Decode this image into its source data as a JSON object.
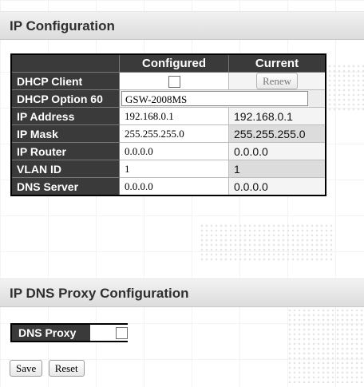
{
  "ip_config": {
    "title": "IP Configuration",
    "columns": {
      "configured": "Configured",
      "current": "Current"
    },
    "dhcp_client": {
      "label": "DHCP Client",
      "checked": false,
      "renew_label": "Renew"
    },
    "dhcp_option_60": {
      "label": "DHCP Option 60",
      "value": "GSW-2008MS"
    },
    "ip_address": {
      "label": "IP Address",
      "configured": "192.168.0.1",
      "current": "192.168.0.1"
    },
    "ip_mask": {
      "label": "IP Mask",
      "configured": "255.255.255.0",
      "current": "255.255.255.0"
    },
    "ip_router": {
      "label": "IP Router",
      "configured": "0.0.0.0",
      "current": "0.0.0.0"
    },
    "vlan_id": {
      "label": "VLAN ID",
      "configured": "1",
      "current": "1"
    },
    "dns_server": {
      "label": "DNS Server",
      "configured": "0.0.0.0",
      "current": "0.0.0.0"
    }
  },
  "dns_proxy_config": {
    "title": "IP DNS Proxy Configuration",
    "dns_proxy": {
      "label": "DNS Proxy",
      "checked": false
    }
  },
  "buttons": {
    "save": "Save",
    "reset": "Reset"
  },
  "colors": {
    "header_dark": "#3a3a3a",
    "section_bar": "#dcdcdc"
  }
}
